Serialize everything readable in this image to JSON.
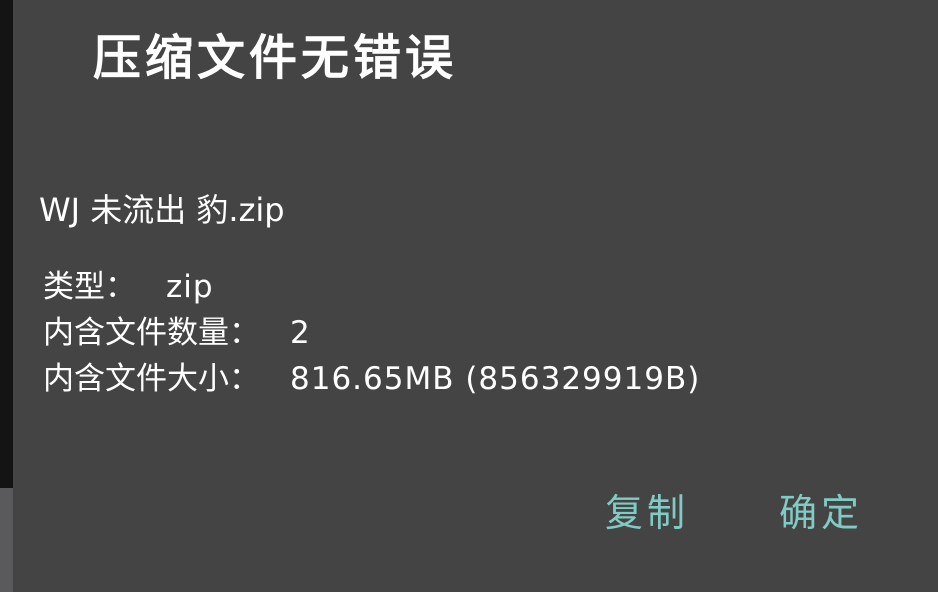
{
  "dialog": {
    "title": "压缩文件无错误",
    "file_name": "WJ 未流出 豹.zip",
    "details": [
      {
        "label": "类型：",
        "value": "zip"
      },
      {
        "label": "内含文件数量：",
        "value": "2"
      },
      {
        "label": "内含文件大小：",
        "value": "816.65MB (856329919B)"
      }
    ],
    "buttons": {
      "copy_label": "复制",
      "ok_label": "确定"
    }
  },
  "colors": {
    "dialog_background": "#444444",
    "text": "#ffffff",
    "accent": "#80cbc4"
  }
}
